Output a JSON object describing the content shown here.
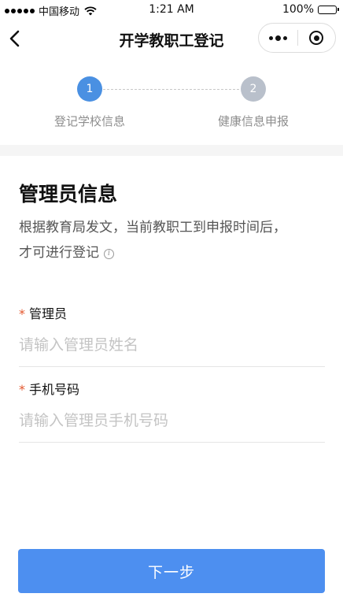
{
  "status_bar": {
    "carrier": "中国移动",
    "time": "1:21 AM",
    "battery": "100%"
  },
  "nav": {
    "title": "开学教职工登记"
  },
  "stepper": {
    "steps": [
      {
        "number": "1",
        "label": "登记学校信息",
        "state": "active"
      },
      {
        "number": "2",
        "label": "健康信息申报",
        "state": "inactive"
      }
    ]
  },
  "section": {
    "title": "管理员信息",
    "desc_line1": "根据教育局发文，当前教职工到申报时间后，",
    "desc_line2": "才可进行登记"
  },
  "form": {
    "fields": [
      {
        "required_mark": "*",
        "label": "管理员",
        "placeholder": "请输入管理员姓名",
        "value": ""
      },
      {
        "required_mark": "*",
        "label": "手机号码",
        "placeholder": "请输入管理员手机号码",
        "value": ""
      }
    ]
  },
  "actions": {
    "next_label": "下一步"
  },
  "colors": {
    "primary": "#4d8ff0",
    "step_active": "#4a90e2",
    "step_inactive": "#b9c0cb",
    "required": "#e4572e"
  },
  "icons": [
    "signal-dots-icon",
    "wifi-icon",
    "battery-icon",
    "back-chevron-icon",
    "more-dots-icon",
    "close-target-icon",
    "info-icon"
  ]
}
